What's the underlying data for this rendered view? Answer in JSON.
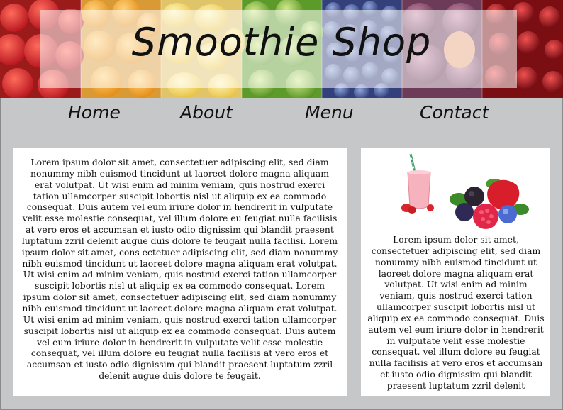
{
  "site": {
    "title": "Smoothie Shop"
  },
  "nav": {
    "items": [
      "Home",
      "About",
      "Menu",
      "Contact"
    ]
  },
  "main": {
    "text": "Lorem ipsum dolor sit amet, consectetuer adipiscing elit, sed diam nonummy nibh euismod tincidunt ut laoreet dolore magna aliquam erat volutpat. Ut wisi enim ad minim veniam, quis nostrud exerci tation ullamcorper suscipit lobortis nisl ut aliquip ex ea commodo consequat. Duis autem vel eum iriure dolor in hendrerit in vulputate velit esse molestie consequat, vel illum dolore eu feugiat nulla facilisis at vero eros et accumsan et iusto odio dignissim qui blandit praesent luptatum zzril delenit augue duis dolore te feugait nulla facilisi. Lorem ipsum dolor sit amet, cons ectetuer adipiscing elit, sed diam nonummy nibh euismod tincidunt ut laoreet dolore magna aliquam erat volutpat. Ut wisi enim ad minim veniam, quis nostrud exerci tation ullamcorper suscipit lobortis nisl ut aliquip ex ea commodo consequat. Lorem ipsum dolor sit amet, consectetuer adipiscing elit, sed diam nonummy nibh euismod tincidunt ut laoreet dolore magna aliquam erat volutpat. Ut wisi enim ad minim veniam, quis nostrud exerci tation ullamcorper suscipit lobortis nisl ut aliquip ex ea commodo consequat. Duis autem vel eum iriure dolor in hendrerit in vulputate velit esse molestie consequat, vel illum dolore eu feugiat nulla facilisis at vero eros et accumsan et iusto odio dignissim qui blandit praesent luptatum zzril delenit augue duis dolore te feugait."
  },
  "sidebar": {
    "text": "Lorem ipsum dolor sit amet, consectetuer adipiscing elit, sed diam nonummy nibh euismod tincidunt ut laoreet dolore magna aliquam erat volutpat. Ut wisi enim ad minim veniam, quis nostrud exerci tation ullamcorper suscipit lobortis nisl ut aliquip ex ea commodo consequat. Duis autem vel eum iriure dolor in hendrerit in vulputate velit esse molestie consequat, vel illum dolore eu feugiat nulla facilisis at vero eros et accumsan et iusto odio dignissim qui blandit praesent luptatum zzril delenit"
  },
  "colors": {
    "background": "#c6c7c9",
    "panel": "#ffffff",
    "text": "#111111"
  },
  "banner_fruits": [
    "strawberry",
    "orange",
    "lemon",
    "lime",
    "blueberry",
    "fig",
    "cherry"
  ],
  "icons": [
    "smoothie-glass-icon",
    "berries-icon"
  ]
}
